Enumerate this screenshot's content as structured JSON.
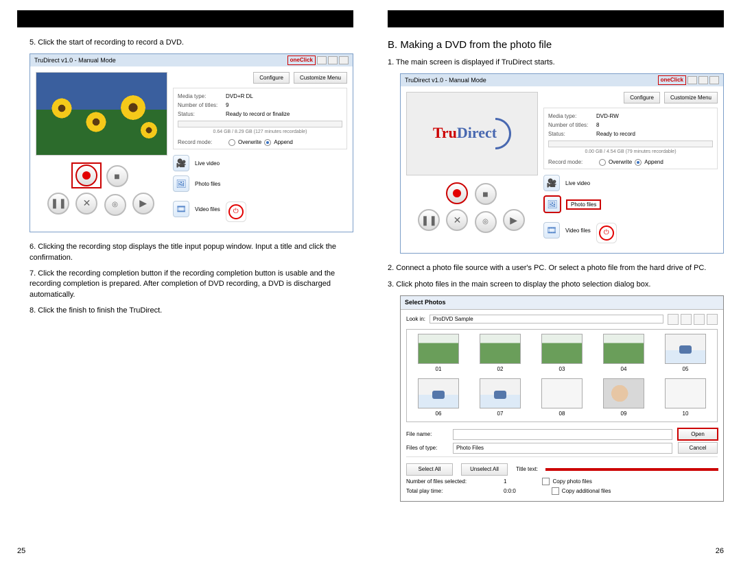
{
  "left": {
    "step5": "5. Click the start of recording to record a DVD.",
    "app_title": "TruDirect v1.0 - Manual Mode",
    "help": "oneClick",
    "configure": "Configure",
    "custom_menu": "Customize Menu",
    "media_type_k": "Media type:",
    "media_type_v": "DVD+R DL",
    "num_titles_k": "Number of titles:",
    "num_titles_v": "9",
    "status_k": "Status:",
    "status_v": "Ready to record or finalize",
    "capacity": "0.64 GB / 8.29 GB (127 minutes recordable)",
    "rec_mode_k": "Record mode:",
    "overwrite": "Overwrite",
    "append": "Append",
    "live_video": "Live video",
    "photo_files": "Photo files",
    "video_files": "Video files",
    "step6": "6. Clicking the recording stop displays the title input popup window. Input a title and click the confirmation.",
    "step7": "7. Click the recording completion button if the recording completion button is usable and the recording completion is prepared. After completion of DVD recording, a DVD is discharged automatically.",
    "step8": "8. Click the finish to finish the TruDirect.",
    "page": "25"
  },
  "right": {
    "heading": "B. Making a DVD from the photo file",
    "step1": "1. The main screen is displayed if TruDirect starts.",
    "app_title": "TruDirect v1.0 - Manual Mode",
    "help": "oneClick",
    "configure": "Configure",
    "custom_menu": "Customize Menu",
    "media_type_k": "Media type:",
    "media_type_v": "DVD-RW",
    "num_titles_k": "Number of titles:",
    "num_titles_v": "8",
    "status_k": "Status:",
    "status_v": "Ready to record",
    "capacity": "0.00 GB / 4.54 GB (79 minutes recordable)",
    "rec_mode_k": "Record mode:",
    "overwrite": "Overwrite",
    "append": "Append",
    "live_video": "Live video",
    "photo_files": "Photo files",
    "video_files": "Video files",
    "step2": "2. Connect a photo file source with a user's PC. Or select a photo file from the hard drive of PC.",
    "step3": "3. Click photo files in the main screen to display the photo selection dialog box.",
    "dlg_title": "Select Photos",
    "look_in": "Look in:",
    "look_in_v": "ProDVD Sample",
    "thumbs": [
      "01",
      "02",
      "03",
      "04",
      "05",
      "06",
      "07",
      "08",
      "09",
      "10"
    ],
    "file_name": "File name:",
    "files_type": "Files of type:",
    "files_type_v": "Photo Files",
    "open": "Open",
    "cancel": "Cancel",
    "select_all": "Select All",
    "unselect_all": "Unselect All",
    "title_text": "Title text:",
    "num_sel_k": "Number of files selected:",
    "num_sel_v": "1",
    "copy_photo": "Copy photo files",
    "total_play_k": "Total play time:",
    "total_play_v": "0:0:0",
    "copy_add": "Copy additional files",
    "page": "26"
  }
}
